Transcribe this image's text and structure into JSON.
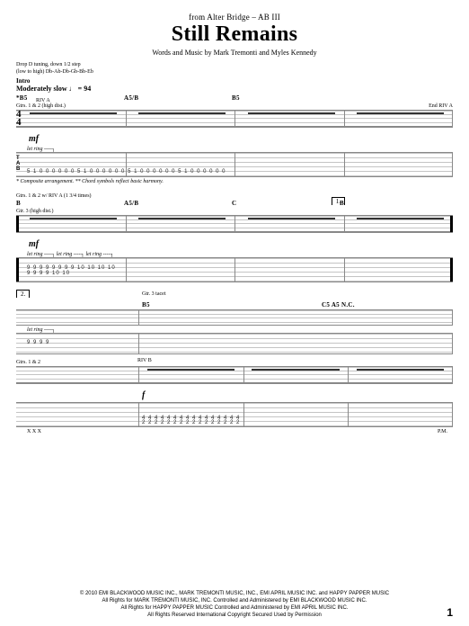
{
  "header": {
    "from": "from Alter Bridge – AB III",
    "title": "Still Remains",
    "credits": "Words and Music by Mark Tremonti and Myles Kennedy"
  },
  "tuning": {
    "l1": "Drop D tuning, down 1/2 step",
    "l2": "(low to high) Db-Ab-Db-Gb-Bb-Eb"
  },
  "intro_label": "Intro",
  "tempo": "Moderately slow ♩ = 94",
  "systems": {
    "s1": {
      "chords": {
        "c1": "*B5",
        "c2": "A5/B",
        "c3": "B5"
      },
      "gtr": "Gtrs. 1 & 2 (high dist.)",
      "riva": "RIV A",
      "riva_end": "End RIV A",
      "timesig": {
        "top": "4",
        "bot": "4"
      },
      "dyn": "mf",
      "note": "* Composite arrangement.                  ** Chord symbols reflect basic harmony.",
      "tab_frets": {
        "row": "5  1 0  0 0  0 0  0    5 1 0  0 0  0 0 0    5  1 0  0 0  0 0  0    5 1 0  0 0  0 0 0"
      },
      "let_ring": "let ring ----┐"
    },
    "s2": {
      "chords": {
        "c1": "B",
        "c2": "A5/B",
        "c3": "C",
        "c4": "B"
      },
      "gtr": "Gtrs. 1 & 2 w/ RIV A (1 3/4 times)",
      "gtr3": "Gtr. 3 (high dist.)",
      "dyn": "mf",
      "box": "1.",
      "tab_row1": "9        9     9    9         9        9     9    9        10       10    10    10",
      "tab_row2": "                                                     ",
      "tab_bottom": "9            9              9            9           10           10",
      "let_ring": "let ring ----┐                    let ring ----┐                    let ring ----┐"
    },
    "s3": {
      "chords": {
        "c1": "B5",
        "c2": "C5  A5  N.C."
      },
      "gtr": "Gtrs. 1 & 2",
      "gtr3_tacet": "Gtr. 3 tacet",
      "box": "2.",
      "tab_row": "9          9     9    9",
      "riva": "RIV B",
      "dyn": "f",
      "let_ring": "let ring ----┐",
      "tab_bottom": "4    4   4  4   4   4   4  4    4    4   4  4   4   4   4  4",
      "tab_bottom2": "2    2   2  2   2   2   2  2    2    2   2  2   2   2   2  2",
      "scratch": "X  X  X",
      "pm": "P.M."
    }
  },
  "footer": {
    "l1": "© 2010 EMI BLACKWOOD MUSIC INC., MARK TREMONTI MUSIC, INC., EMI APRIL MUSIC INC. and HAPPY PAPPER MUSIC",
    "l2": "All Rights for MARK TREMONTI MUSIC, INC. Controlled and Administered by EMI BLACKWOOD MUSIC INC.",
    "l3": "All Rights for HAPPY PAPPER MUSIC Controlled and Administered by EMI APRIL MUSIC INC.",
    "l4": "All Rights Reserved   International Copyright Secured   Used by Permission"
  },
  "pagenum": "1"
}
